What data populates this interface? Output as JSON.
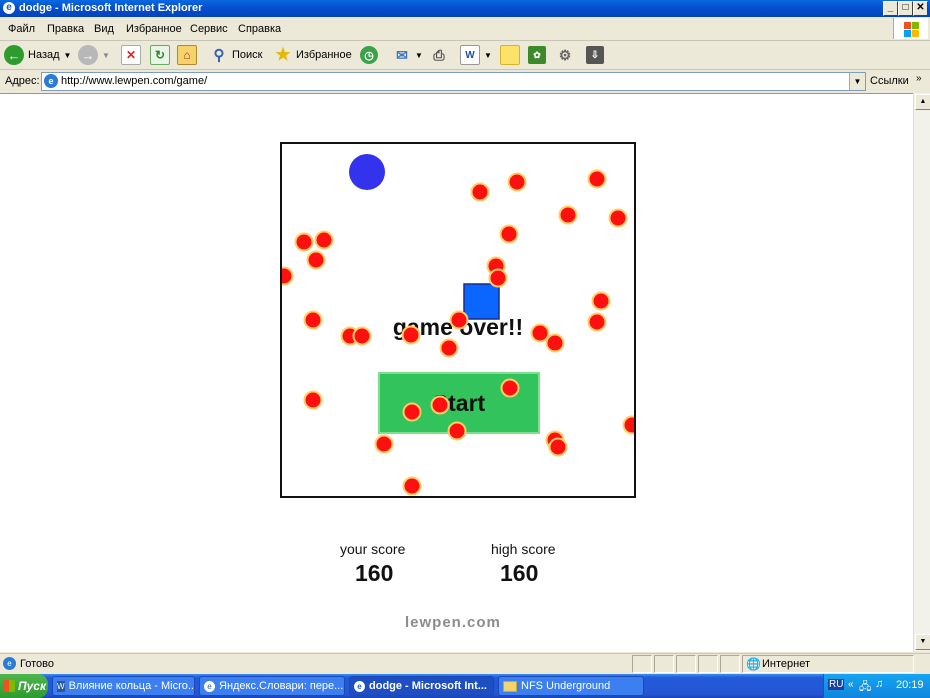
{
  "window": {
    "title": "dodge - Microsoft Internet Explorer",
    "controls": [
      "_",
      "□",
      "✕"
    ]
  },
  "menu": [
    "Файл",
    "Правка",
    "Вид",
    "Избранное",
    "Сервис",
    "Справка"
  ],
  "toolbar": {
    "back_label": "Назад",
    "search_label": "Поиск",
    "favorites_label": "Избранное"
  },
  "address": {
    "label": "Адрес:",
    "url": "http://www.lewpen.com/game/",
    "links_label": "Ссылки"
  },
  "game": {
    "game_over_text": "game over!!",
    "start_label": "Start",
    "player_color": "#3333ee",
    "square_color": "#0a66ff",
    "ball_color": "#ff1010",
    "ball_border_color": "#ffcc66",
    "start_button_color": "#33c35c"
  },
  "scores": {
    "your_label": "your score",
    "your_value": "160",
    "high_label": "high score",
    "high_value": "160"
  },
  "brand": "lewpen.com",
  "status": {
    "text": "Готово",
    "zone": "Интернет"
  },
  "taskbar": {
    "start_label": "Пуск",
    "tasks": [
      "Влияние кольца - Micro...",
      "Яндекс.Словари: пере...",
      "dodge - Microsoft Int...",
      "NFS Underground"
    ],
    "lang": "RU",
    "clock": "20:19"
  }
}
